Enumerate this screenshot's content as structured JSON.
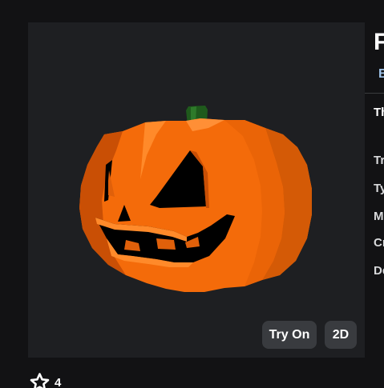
{
  "viewer": {
    "try_on_label": "Try On",
    "two_d_label": "2D"
  },
  "item": {
    "title": "F",
    "byline": "B",
    "description": "Th",
    "details": [
      {
        "key": "trade",
        "label": "Tr"
      },
      {
        "key": "type",
        "label": "Ty"
      },
      {
        "key": "m",
        "label": "M"
      },
      {
        "key": "created",
        "label": "Cr"
      },
      {
        "key": "description",
        "label": "De"
      }
    ]
  },
  "favorites": {
    "icon": "star-icon",
    "count": "4"
  },
  "colors": {
    "page_bg": "#121214",
    "viewer_bg": "#1e1f22",
    "button_bg": "#393b3f",
    "pumpkin_orange": "#f46b0a",
    "stem_green": "#1f5a1c",
    "byline_blue": "#9ec2e8"
  }
}
